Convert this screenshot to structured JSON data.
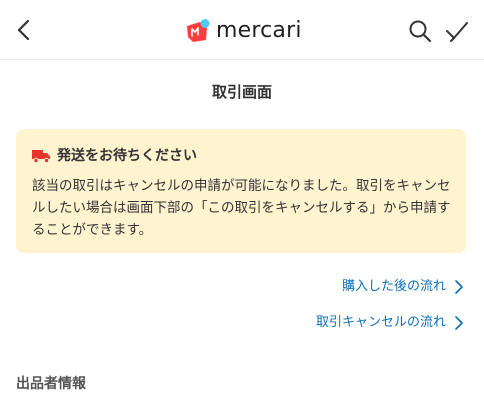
{
  "header": {
    "logo_text": "mercari",
    "icons": {
      "back": "chevron-left-icon",
      "search": "search-icon",
      "check": "check-icon"
    }
  },
  "page": {
    "title": "取引画面"
  },
  "notice": {
    "title": "発送をお待ちください",
    "body": "該当の取引はキャンセルの申請が可能になりました。取引をキャンセルしたい場合は画面下部の「この取引をキャンセルする」から申請することができます。",
    "icon": "truck-icon",
    "background": "#fff3d0",
    "icon_color": "#e8352b"
  },
  "links": [
    {
      "label": "購入した後の流れ"
    },
    {
      "label": "取引キャンセルの流れ"
    }
  ],
  "sections": {
    "seller_info": "出品者情報"
  },
  "colors": {
    "link": "#0f6fb5",
    "brand_red": "#ff3d3d",
    "brand_blue": "#4dc9f6"
  }
}
